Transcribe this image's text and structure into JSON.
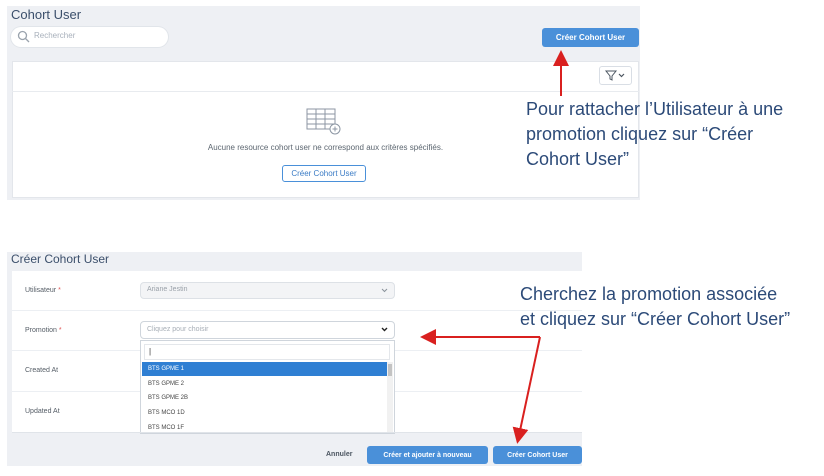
{
  "panel1": {
    "title": "Cohort User",
    "search_placeholder": "Rechercher",
    "create_button": "Créer Cohort User",
    "empty_message": "Aucune resource cohort user ne correspond aux critères spécifiés.",
    "empty_button": "Créer Cohort User",
    "icons": [
      "search-icon",
      "filter-icon",
      "chevron-down-icon",
      "table-add-icon"
    ]
  },
  "panel2": {
    "title": "Créer Cohort User",
    "fields": [
      {
        "label": "Utilisateur",
        "required": "*",
        "value": "Ariane Jestin"
      },
      {
        "label": "Promotion",
        "required": "*",
        "placeholder": "Cliquez pour choisir"
      },
      {
        "label": "Created At"
      },
      {
        "label": "Updated At"
      }
    ],
    "dropdown": {
      "search_value": "",
      "options": [
        "BTS GPME 1",
        "BTS GPME 2",
        "BTS GPME 2B",
        "BTS MCO 1D",
        "BTS MCO 1F"
      ],
      "selected_index": 0
    },
    "buttons": {
      "cancel": "Annuler",
      "create_again": "Créer et ajouter à nouveau",
      "create": "Créer Cohort User"
    }
  },
  "annotations": {
    "note1_lines": [
      "Pour rattacher l’Utilisateur à une",
      "promotion cliquez sur “Créer",
      "Cohort User”"
    ],
    "note2_lines": [
      "Cherchez la promotion associée",
      "et cliquez sur “Créer Cohort User”"
    ],
    "arrow_color": "#d9201f"
  },
  "colors": {
    "primary_button": "#4a90d9",
    "selected_option": "#2f7fd3",
    "panel_background": "#eef0f4",
    "annotation_text": "#2c4a78"
  }
}
